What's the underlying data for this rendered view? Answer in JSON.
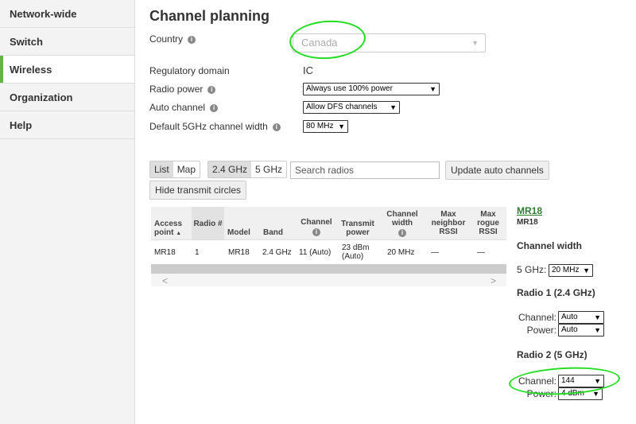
{
  "sidebar": {
    "items": [
      {
        "label": "Network-wide"
      },
      {
        "label": "Switch"
      },
      {
        "label": "Wireless"
      },
      {
        "label": "Organization"
      },
      {
        "label": "Help"
      }
    ]
  },
  "page": {
    "title": "Channel planning",
    "country_label": "Country",
    "country_value": "Canada",
    "regulatory_label": "Regulatory domain",
    "regulatory_value": "IC",
    "radio_power_label": "Radio power",
    "radio_power_value": "Always use 100% power",
    "auto_channel_label": "Auto channel",
    "auto_channel_value": "Allow DFS channels",
    "width_label": "Default 5GHz channel width",
    "width_value": "80 MHz"
  },
  "toolbar": {
    "list": "List",
    "map": "Map",
    "band_24": "2.4 GHz",
    "band_5": "5 GHz",
    "search_placeholder": "Search radios",
    "update_button": "Update auto channels",
    "hide_button": "Hide transmit circles"
  },
  "table": {
    "headers": {
      "access_point": "Access point",
      "sort_arrow": "▲",
      "radio": "Radio #",
      "model": "Model",
      "band": "Band",
      "channel": "Channel",
      "transmit": "Transmit power",
      "width": "Channel width",
      "neighbor": "Max neighbor RSSI",
      "rogue": "Max rogue RSSI"
    },
    "row": {
      "access_point": "MR18",
      "radio": "1",
      "model": "MR18",
      "band": "2.4 GHz",
      "channel": "11 (Auto)",
      "transmit": "23 dBm (Auto)",
      "width": "20 MHz",
      "neighbor": "—",
      "rogue": "—"
    }
  },
  "panel": {
    "ap_link": "MR18",
    "ap_model": "MR18",
    "channel_width_heading": "Channel width",
    "ghz5_label": "5 GHz:",
    "ghz5_value": "20 MHz",
    "radio1_heading": "Radio 1 (2.4 GHz)",
    "r1_channel_label": "Channel:",
    "r1_channel_value": "Auto",
    "r1_power_label": "Power:",
    "r1_power_value": "Auto",
    "radio2_heading": "Radio 2 (5 GHz)",
    "r2_channel_label": "Channel:",
    "r2_channel_value": "144",
    "r2_power_label": "Power:",
    "r2_power_value": "4 dBm"
  },
  "colors": {
    "accent": "#67b346",
    "annotation": "#22dd22",
    "link": "#2e7d32"
  }
}
